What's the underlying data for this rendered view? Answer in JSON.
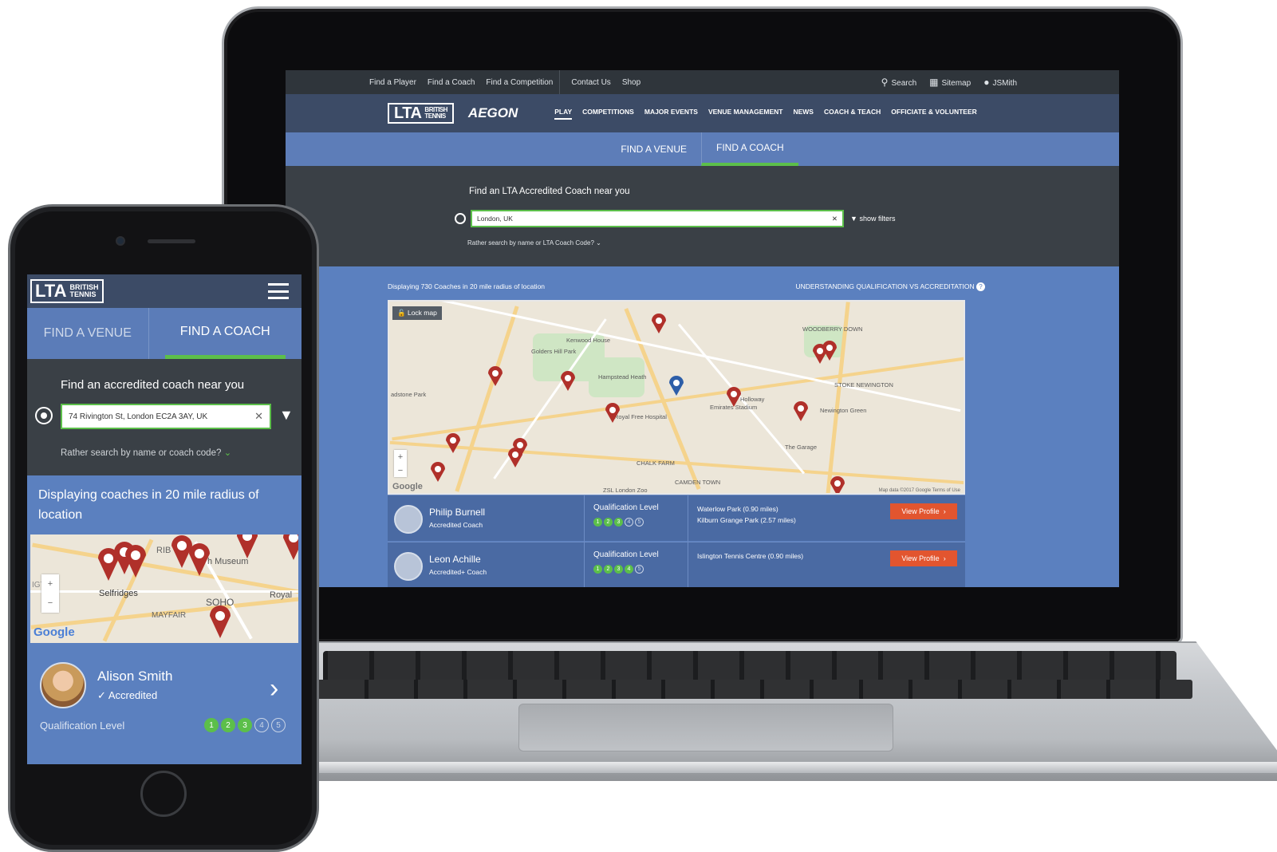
{
  "laptop": {
    "utility_nav": [
      "Find a Player",
      "Find a Coach",
      "Find a Competition"
    ],
    "utility_nav_right": [
      "Contact Us",
      "Shop"
    ],
    "utility_actions": {
      "search": "Search",
      "sitemap": "Sitemap",
      "user": "JSMith"
    },
    "logo": {
      "main": "LTA",
      "sub1": "BRITISH",
      "sub2": "TENNIS",
      "sponsor": "AEGON"
    },
    "main_nav": [
      "PLAY",
      "COMPETITIONS",
      "MAJOR EVENTS",
      "VENUE MANAGEMENT",
      "NEWS",
      "COACH & TEACH",
      "OFFICIATE & VOLUNTEER"
    ],
    "tabs": {
      "venue": "FIND A VENUE",
      "coach": "FIND A COACH"
    },
    "search": {
      "heading": "Find an LTA Accredited Coach near you",
      "value": "London, UK",
      "show_filters": "show filters",
      "alt_search": "Rather search by name or LTA Coach Code?"
    },
    "results": {
      "summary": "Displaying 730 Coaches in 20 mile radius of location",
      "help_link": "UNDERSTANDING QUALIFICATION VS ACCREDITATION",
      "lock_map": "Lock map",
      "map_credit": "Map data ©2017 Google   Terms of Use",
      "map_labels": [
        "Kenwood House",
        "Golders Hill Park",
        "Hampstead Heath",
        "Royal Free Hospital",
        "Emirates Stadium",
        "Holloway",
        "STOKE NEWINGTON",
        "Newington Green",
        "The Garage",
        "CHALK FARM",
        "CAMDEN TOWN",
        "ZSL London Zoo",
        "WOODBERRY DOWN",
        "adstone Park"
      ],
      "coaches": [
        {
          "name": "Philip Burnell",
          "status": "Accredited Coach",
          "qual_label": "Qualification Level",
          "levels": [
            "1",
            "2",
            "3",
            "4",
            "5"
          ],
          "achieved": 3,
          "venues": [
            "Waterlow Park (0.90 miles)",
            "Kilburn Grange Park (2.57 miles)"
          ],
          "button": "View Profile"
        },
        {
          "name": "Leon Achille",
          "status": "Accredited+ Coach",
          "qual_label": "Qualification Level",
          "levels": [
            "1",
            "2",
            "3",
            "4",
            "5"
          ],
          "achieved": 4,
          "venues": [
            "Islington Tennis Centre (0.90 miles)"
          ],
          "button": "View Profile"
        }
      ]
    }
  },
  "phone": {
    "logo": {
      "main": "LTA",
      "sub1": "BRITISH",
      "sub2": "TENNIS"
    },
    "tabs": {
      "venue": "FIND A VENUE",
      "coach": "FIND A COACH"
    },
    "search": {
      "heading": "Find an accredited coach near you",
      "value": "74 Rivington St, London EC2A 3AY, UK",
      "alt_search": "Rather search by name or coach code?"
    },
    "results": {
      "summary": "Displaying coaches in 20 mile radius of location",
      "map_labels": [
        "Selfridges",
        "SOHO",
        "MAYFAIR",
        "h Museum",
        "Royal",
        "IGTON",
        "RIB"
      ],
      "coach": {
        "name": "Alison Smith",
        "status": "Accredited",
        "qual_label": "Qualification Level",
        "levels": [
          "1",
          "2",
          "3",
          "4",
          "5"
        ],
        "achieved": 3
      }
    }
  },
  "colors": {
    "nav_navy": "#3c4b66",
    "tab_blue": "#5b7cb8",
    "results_blue": "#5b80bf",
    "accent_green": "#5cbf4a",
    "cta_orange": "#e2552f",
    "pin_red": "#b0302a",
    "pin_blue": "#2d5ea8"
  }
}
